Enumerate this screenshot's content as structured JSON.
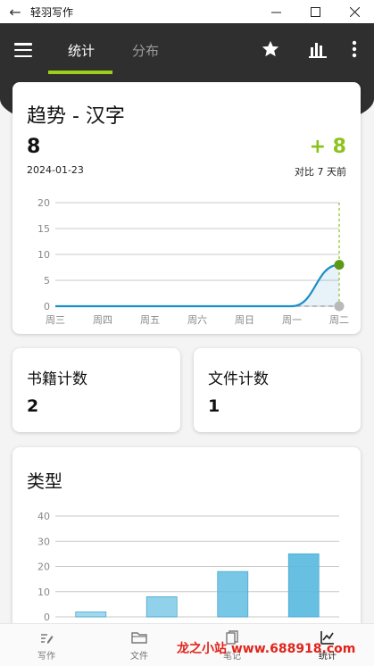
{
  "window": {
    "title": "轻羽写作"
  },
  "tabs": [
    {
      "label": "统计",
      "active": true
    },
    {
      "label": "分布",
      "active": false
    }
  ],
  "colors": {
    "accent": "#9ccf1a",
    "delta": "#8bc21d",
    "line": "#1a8ec9",
    "bar": "#5bbbe0",
    "header": "#2f2f2f"
  },
  "trend": {
    "title": "趋势 - 汉字",
    "count": "8",
    "date": "2024-01-23",
    "delta": "+ 8",
    "compare": "对比 7 天前"
  },
  "chart_data": [
    {
      "type": "line",
      "x": [
        "周三",
        "周四",
        "周五",
        "周六",
        "周日",
        "周一",
        "周二"
      ],
      "series": [
        {
          "values": [
            0,
            0,
            0,
            0,
            0,
            0,
            8
          ]
        },
        {
          "values": [
            0,
            0,
            0,
            0,
            0,
            0,
            0
          ]
        }
      ],
      "yticks": [
        "20",
        "15",
        "10",
        "5",
        "0"
      ],
      "ylim": [
        0,
        20
      ],
      "grid": true
    },
    {
      "type": "bar",
      "categories": [
        "",
        "",
        "",
        ""
      ],
      "values": [
        2,
        8,
        18,
        25
      ],
      "yticks": [
        "40",
        "30",
        "20",
        "10",
        "0"
      ],
      "ylim": [
        0,
        40
      ],
      "grid": true
    }
  ],
  "stats": {
    "books_label": "书籍计数",
    "books_value": "2",
    "files_label": "文件计数",
    "files_value": "1"
  },
  "types": {
    "title": "类型"
  },
  "bottom_nav": [
    {
      "label": "写作",
      "icon": "pen-icon"
    },
    {
      "label": "文件",
      "icon": "folder-icon"
    },
    {
      "label": "笔记",
      "icon": "notes-icon"
    },
    {
      "label": "统计",
      "icon": "stats-icon",
      "active": true
    }
  ],
  "watermark": "龙之小站 www.688918.com"
}
